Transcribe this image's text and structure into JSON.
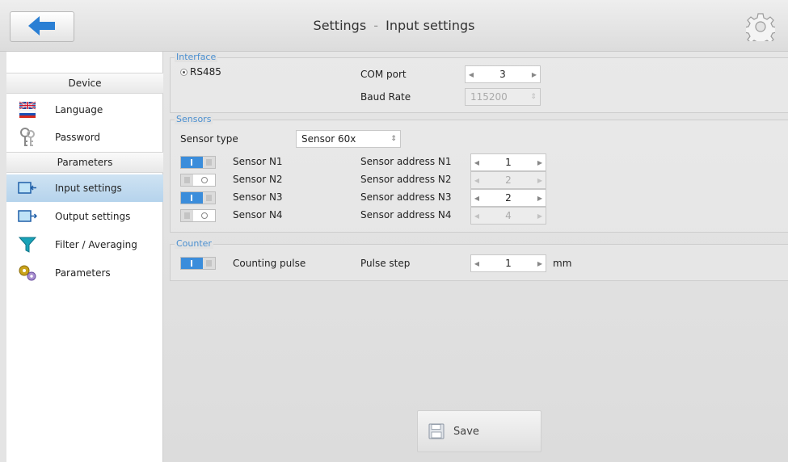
{
  "header": {
    "title": "Settings",
    "separator": "-",
    "subtitle": "Input settings",
    "back_icon": "back-arrow-icon",
    "settings_icon": "gear-icon"
  },
  "sidebar": {
    "sections": [
      {
        "label": "Device"
      },
      {
        "label": "Parameters"
      }
    ],
    "items": [
      {
        "label": "Language",
        "icon": "flag-language-icon"
      },
      {
        "label": "Password",
        "icon": "keys-icon"
      },
      {
        "label": "Input settings",
        "icon": "input-icon",
        "active": true
      },
      {
        "label": "Output settings",
        "icon": "output-icon"
      },
      {
        "label": "Filter / Averaging",
        "icon": "funnel-icon"
      },
      {
        "label": "Parameters",
        "icon": "gears-icon"
      }
    ]
  },
  "interface": {
    "title": "Interface",
    "radio_label": "RS485",
    "com_port_label": "COM port",
    "com_port_value": "3",
    "baud_rate_label": "Baud Rate",
    "baud_rate_value": "115200"
  },
  "sensors": {
    "title": "Sensors",
    "type_label": "Sensor type",
    "type_value": "Sensor 60x",
    "rows": [
      {
        "name": "Sensor N1",
        "enabled": true,
        "address_label": "Sensor address N1",
        "address": "1"
      },
      {
        "name": "Sensor N2",
        "enabled": false,
        "address_label": "Sensor address N2",
        "address": "2"
      },
      {
        "name": "Sensor N3",
        "enabled": true,
        "address_label": "Sensor address N3",
        "address": "2"
      },
      {
        "name": "Sensor N4",
        "enabled": false,
        "address_label": "Sensor address N4",
        "address": "4"
      }
    ]
  },
  "counter": {
    "title": "Counter",
    "pulse_label": "Counting pulse",
    "pulse_enabled": true,
    "step_label": "Pulse step",
    "step_value": "1",
    "step_unit": "mm"
  },
  "save": {
    "label": "Save",
    "icon": "floppy-disk-icon"
  },
  "colors": {
    "accent": "#3b8ddb",
    "active_row": "#c3dbef",
    "group_title": "#4a8fd0"
  }
}
